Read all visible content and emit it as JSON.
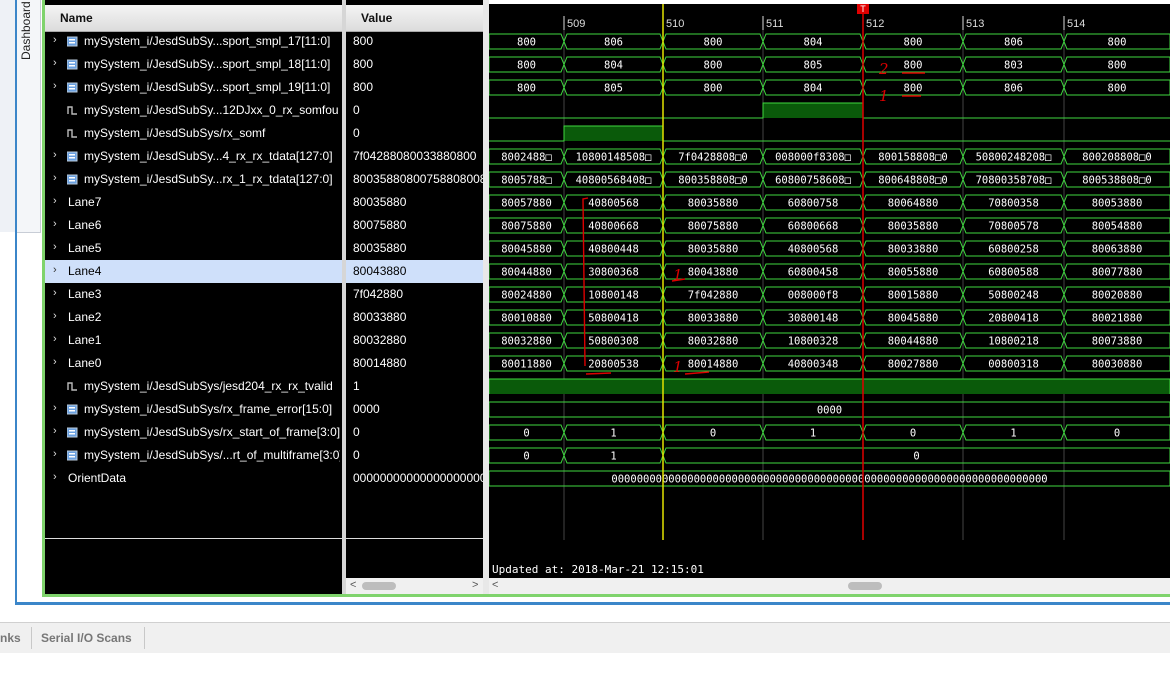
{
  "dashboard_tab_label": "Dashboard",
  "columns": {
    "name": "Name",
    "value": "Value"
  },
  "colors": {
    "wave_green": "#3fd83f",
    "cursor_yellow": "#e2e200",
    "marker_red": "#e00000",
    "selected_row": "#cfe0fa"
  },
  "signals": [
    {
      "name": "mySystem_i/JesdSubSy...sport_smpl_17[11:0]",
      "value": "800",
      "icon": "bus-icon",
      "expandable": true
    },
    {
      "name": "mySystem_i/JesdSubSy...sport_smpl_18[11:0]",
      "value": "800",
      "icon": "bus-icon",
      "expandable": true
    },
    {
      "name": "mySystem_i/JesdSubSy...sport_smpl_19[11:0]",
      "value": "800",
      "icon": "bus-icon",
      "expandable": true
    },
    {
      "name": "mySystem_i/JesdSubSy...12DJxx_0_rx_somfou",
      "value": "0",
      "icon": "bit-icon",
      "expandable": false
    },
    {
      "name": "mySystem_i/JesdSubSys/rx_somf",
      "value": "0",
      "icon": "bit-icon",
      "expandable": false
    },
    {
      "name": "mySystem_i/JesdSubSy...4_rx_rx_tdata[127:0]",
      "value": "7f04288080033880800",
      "icon": "bus-icon",
      "expandable": true
    },
    {
      "name": "mySystem_i/JesdSubSy...rx_1_rx_tdata[127:0]",
      "value": "80035880800758808008",
      "icon": "bus-icon",
      "expandable": true
    },
    {
      "name": "Lane7",
      "value": "80035880",
      "icon": "",
      "expandable": true
    },
    {
      "name": "Lane6",
      "value": "80075880",
      "icon": "",
      "expandable": true
    },
    {
      "name": "Lane5",
      "value": "80035880",
      "icon": "",
      "expandable": true
    },
    {
      "name": "Lane4",
      "value": "80043880",
      "icon": "",
      "expandable": true,
      "selected": true
    },
    {
      "name": "Lane3",
      "value": "7f042880",
      "icon": "",
      "expandable": true
    },
    {
      "name": "Lane2",
      "value": "80033880",
      "icon": "",
      "expandable": true
    },
    {
      "name": "Lane1",
      "value": "80032880",
      "icon": "",
      "expandable": true
    },
    {
      "name": "Lane0",
      "value": "80014880",
      "icon": "",
      "expandable": true
    },
    {
      "name": "mySystem_i/JesdSubSys/jesd204_rx_rx_tvalid",
      "value": "1",
      "icon": "bit-icon",
      "expandable": false
    },
    {
      "name": "mySystem_i/JesdSubSys/rx_frame_error[15:0]",
      "value": "0000",
      "icon": "bus-icon",
      "expandable": true
    },
    {
      "name": "mySystem_i/JesdSubSys/rx_start_of_frame[3:0]",
      "value": "0",
      "icon": "bus-icon",
      "expandable": true
    },
    {
      "name": "mySystem_i/JesdSubSys/...rt_of_multiframe[3:0]",
      "value": "0",
      "icon": "bus-icon",
      "expandable": true
    },
    {
      "name": "OrientData",
      "value": "0000000000000000000000",
      "icon": "",
      "expandable": true
    }
  ],
  "timeline": {
    "ticks": [
      "509",
      "510",
      "511",
      "512",
      "513",
      "514"
    ],
    "marker_label": "T"
  },
  "waves": [
    {
      "type": "bus",
      "segments": [
        "800",
        "806",
        "800",
        "804",
        "800",
        "806",
        "800"
      ]
    },
    {
      "type": "bus",
      "segments": [
        "800",
        "804",
        "800",
        "805",
        "800",
        "803",
        "800"
      ]
    },
    {
      "type": "bus",
      "segments": [
        "800",
        "805",
        "800",
        "804",
        "800",
        "806",
        "800"
      ]
    },
    {
      "type": "bit",
      "high": [
        [
          3,
          4
        ]
      ]
    },
    {
      "type": "bit",
      "high": [
        [
          1,
          2
        ]
      ]
    },
    {
      "type": "bus",
      "segments": [
        "8002488□",
        "10800148508□",
        "7f0428808□0",
        "008000f8308□",
        "800158808□0",
        "50800248208□",
        "800208808□0"
      ]
    },
    {
      "type": "bus",
      "segments": [
        "8005788□",
        "40800568408□",
        "800358808□0",
        "60800758608□",
        "800648808□0",
        "70800358708□",
        "800538808□0"
      ]
    },
    {
      "type": "bus",
      "segments": [
        "80057880",
        "40800568",
        "80035880",
        "60800758",
        "80064880",
        "70800358",
        "80053880"
      ]
    },
    {
      "type": "bus",
      "segments": [
        "80075880",
        "40800668",
        "80075880",
        "60800668",
        "80035880",
        "70800578",
        "80054880"
      ]
    },
    {
      "type": "bus",
      "segments": [
        "80045880",
        "40800448",
        "80035880",
        "40800568",
        "80033880",
        "60800258",
        "80063880"
      ]
    },
    {
      "type": "bus",
      "segments": [
        "80044880",
        "30800368",
        "80043880",
        "60800458",
        "80055880",
        "60800588",
        "80077880"
      ]
    },
    {
      "type": "bus",
      "segments": [
        "80024880",
        "10800148",
        "7f042880",
        "008000f8",
        "80015880",
        "50800248",
        "80020880"
      ]
    },
    {
      "type": "bus",
      "segments": [
        "80010880",
        "50800418",
        "80033880",
        "30800148",
        "80045880",
        "20800418",
        "80021880"
      ]
    },
    {
      "type": "bus",
      "segments": [
        "80032880",
        "50800308",
        "80032880",
        "10800328",
        "80044880",
        "10800218",
        "80073880"
      ]
    },
    {
      "type": "bus",
      "segments": [
        "80011880",
        "20800538",
        "80014880",
        "40800348",
        "80027880",
        "00800318",
        "80030880"
      ]
    },
    {
      "type": "bit",
      "high": [
        [
          0,
          7
        ]
      ]
    },
    {
      "type": "bus",
      "segments": [
        "0000"
      ],
      "span": [
        [
          0,
          7
        ]
      ]
    },
    {
      "type": "bus",
      "segments": [
        "0",
        "1",
        "0",
        "1",
        "0",
        "1",
        "0"
      ]
    },
    {
      "type": "bus",
      "segments": [
        "0",
        "1",
        "0"
      ],
      "span": [
        [
          0,
          1
        ],
        [
          1,
          2
        ],
        [
          2,
          7
        ]
      ]
    },
    {
      "type": "bus",
      "segments": [
        "000000000000000000000000000000000000000000000000000000000000000000000"
      ],
      "span": [
        [
          0,
          7
        ]
      ]
    }
  ],
  "annotations": [
    "2",
    "1",
    "1",
    "1"
  ],
  "updated_at": "Updated at: 2018-Mar-21 12:15:01",
  "bottom_tabs": [
    "nks",
    "Serial I/O Scans"
  ]
}
